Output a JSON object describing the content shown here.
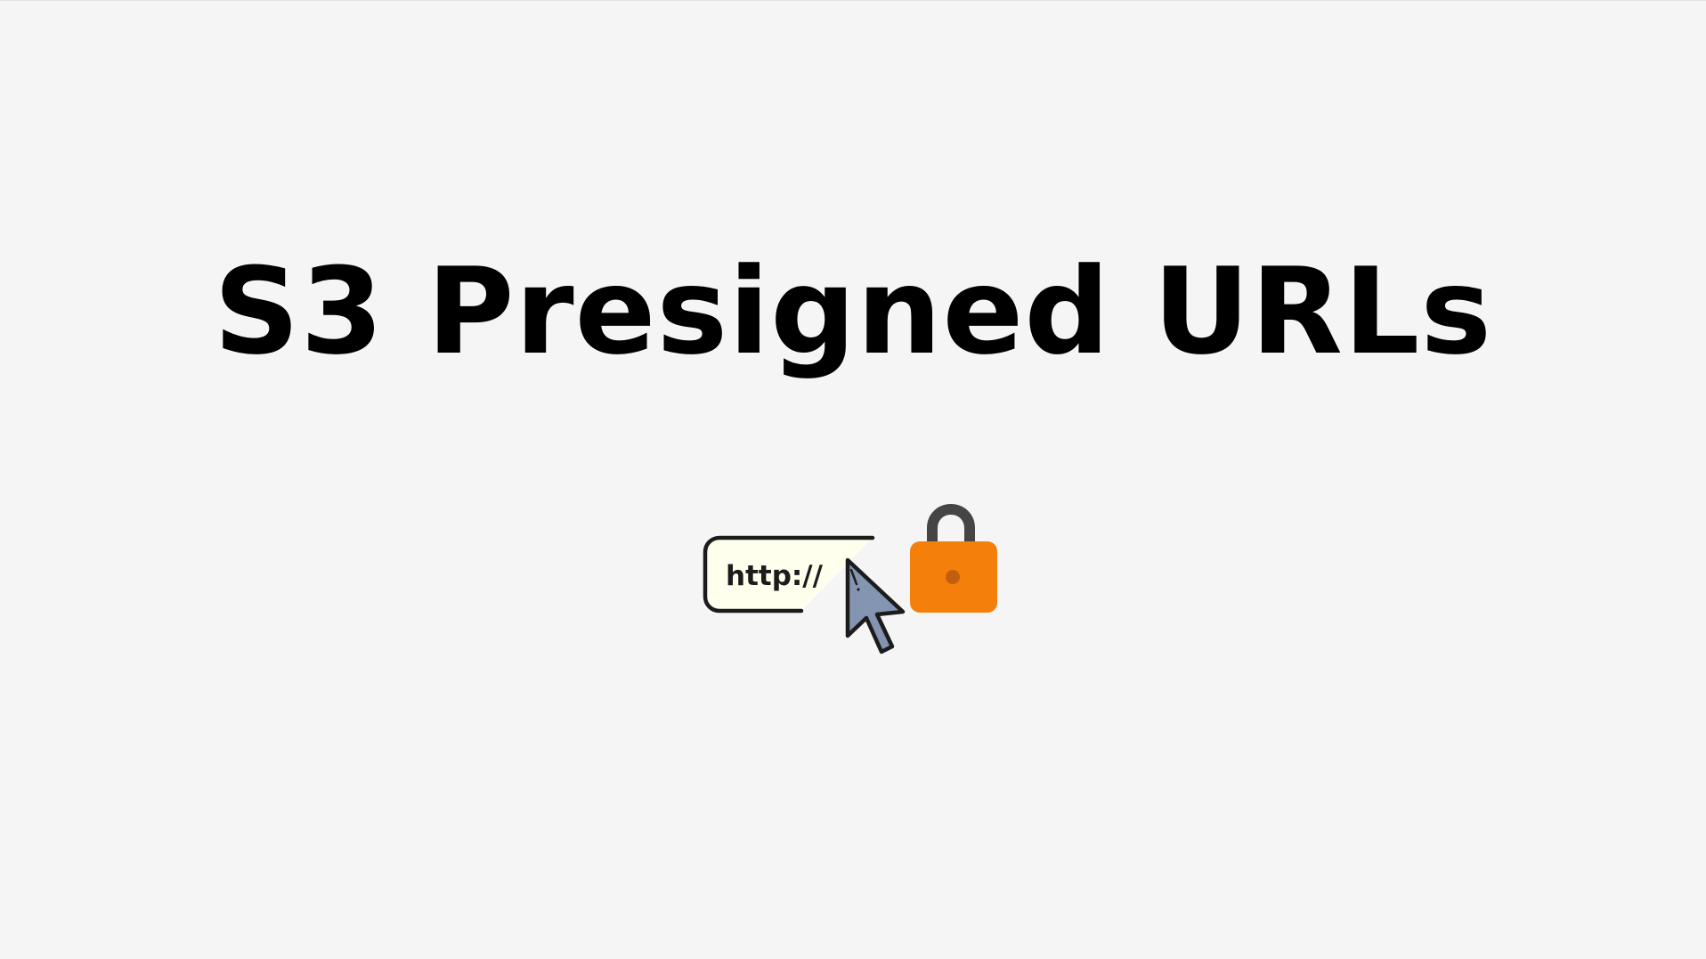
{
  "slide": {
    "title": "S3 Presigned URLs"
  },
  "illustration": {
    "url_text": "http://",
    "icons": [
      "url-bar-icon",
      "cursor-arrow-icon",
      "padlock-icon"
    ],
    "colors": {
      "background": "#f5f5f5",
      "title": "#000000",
      "url_bar_fill": "#ffffee",
      "outline": "#1c1c1c",
      "cursor_fill": "#8395b0",
      "lock_body": "#f57f0b",
      "lock_keyhole": "#c35e10",
      "lock_shackle": "#454545"
    }
  }
}
